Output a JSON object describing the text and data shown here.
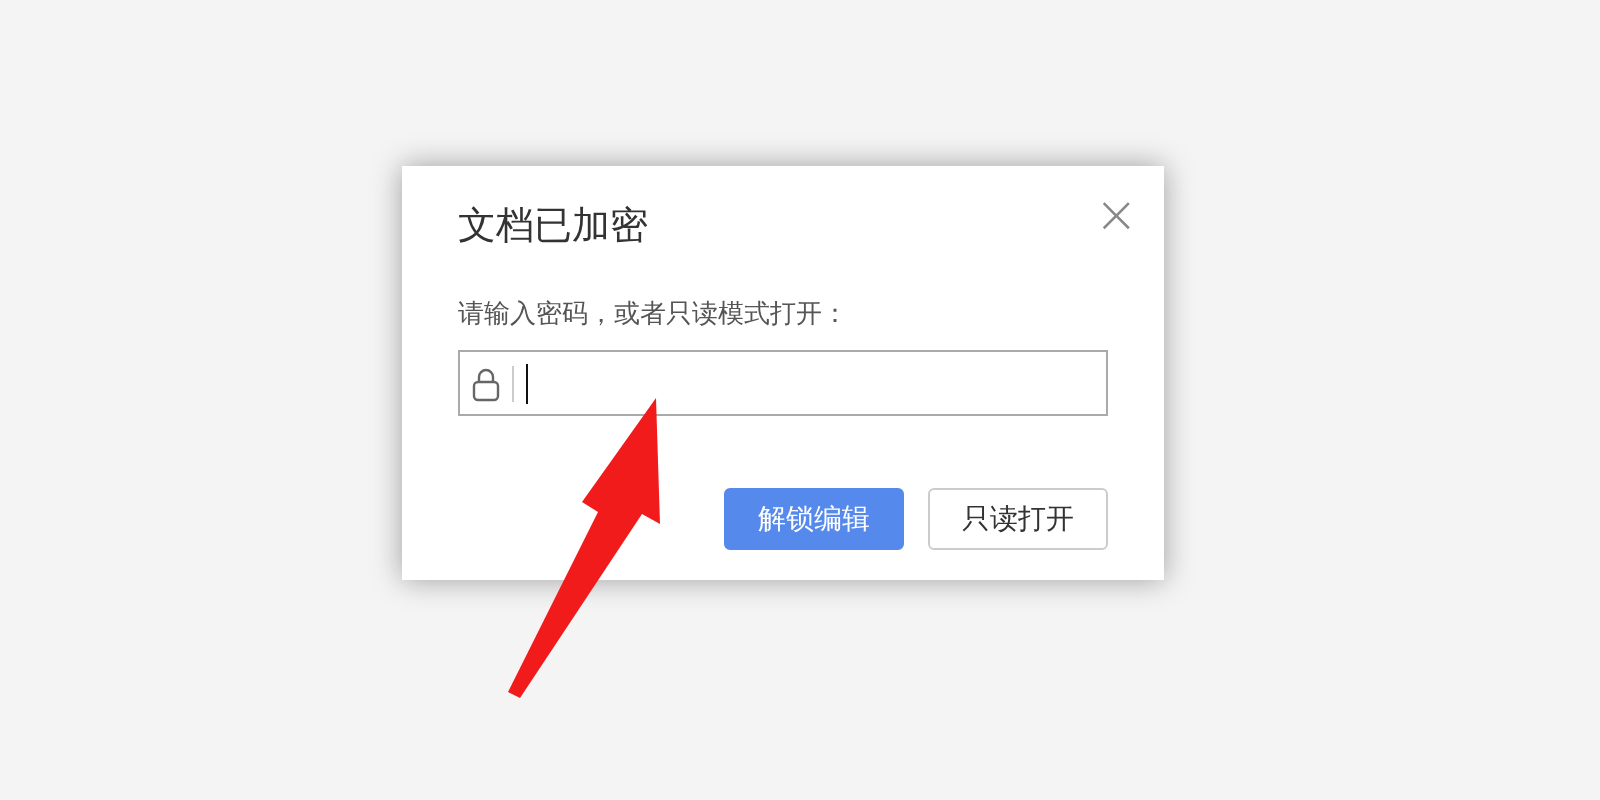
{
  "dialog": {
    "title": "文档已加密",
    "close": "×",
    "prompt": "请输入密码，或者只读模式打开：",
    "buttons": [
      {
        "label": "解锁编辑",
        "kind": "primary"
      },
      {
        "label": "只读打开",
        "kind": "secondary"
      }
    ]
  }
}
